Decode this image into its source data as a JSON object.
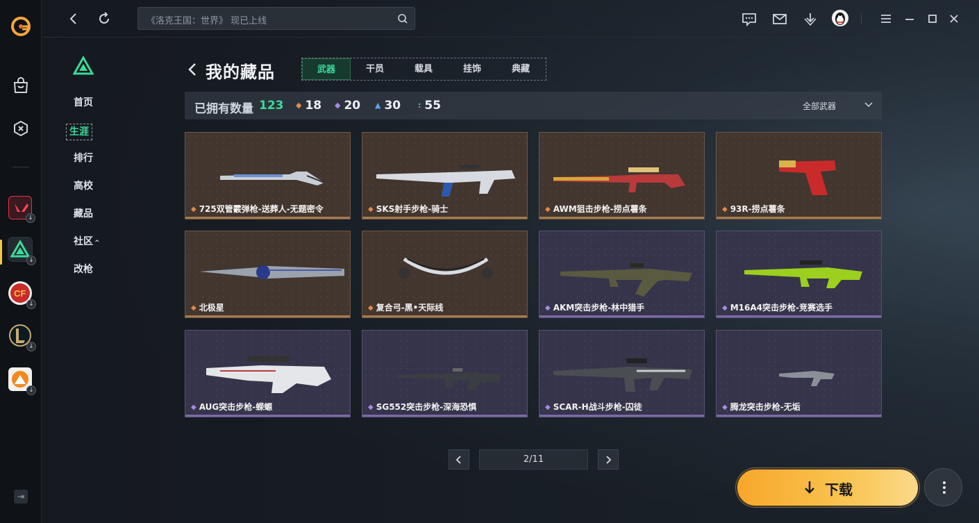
{
  "topbar": {
    "search_placeholder": "《洛克王国：世界》 现已上线"
  },
  "sidenav": {
    "items": [
      "首页",
      "生涯",
      "排行",
      "高校",
      "藏品",
      "社区",
      "改枪"
    ],
    "active_index": 1
  },
  "header": {
    "title": "我的藏品",
    "tabs": [
      "武器",
      "干员",
      "载具",
      "挂饰",
      "典藏"
    ],
    "active_tab": 0
  },
  "summary": {
    "owned_label": "已拥有数量",
    "owned_count": "123",
    "stats": [
      {
        "icon": "orange-diamond-icon",
        "value": "18",
        "color": "#e08a4e"
      },
      {
        "icon": "purple-diamond-icon",
        "value": "20",
        "color": "#a78be6"
      },
      {
        "icon": "blue-chevron-icon",
        "value": "30",
        "color": "#5aa3e6"
      },
      {
        "icon": "green-dots-icon",
        "value": "55",
        "color": "#3cd99a"
      }
    ],
    "filter_label": "全部武器"
  },
  "items": [
    {
      "name": "725双管霰弹枪-送葬人-无题密令",
      "rarity": "gold"
    },
    {
      "name": "SKS射手步枪-骑士",
      "rarity": "gold"
    },
    {
      "name": "AWM狙击步枪-捞点薯条",
      "rarity": "gold"
    },
    {
      "name": "93R-捞点薯条",
      "rarity": "gold"
    },
    {
      "name": "北极星",
      "rarity": "gold"
    },
    {
      "name": "复合弓-黑•天际线",
      "rarity": "gold"
    },
    {
      "name": "AKM突击步枪-林中猎手",
      "rarity": "purple"
    },
    {
      "name": "M16A4突击步枪-竞赛选手",
      "rarity": "purple"
    },
    {
      "name": "AUG突击步枪-蝾螈",
      "rarity": "purple"
    },
    {
      "name": "SG552突击步枪-深海恐惧",
      "rarity": "purple"
    },
    {
      "name": "SCAR-H战斗步枪-囚徒",
      "rarity": "purple"
    },
    {
      "name": "腾龙突击步枪-无垢",
      "rarity": "purple"
    }
  ],
  "pagination": {
    "page_text": "2/11",
    "prev": "<",
    "next": ">"
  },
  "download": {
    "label": "下载"
  }
}
